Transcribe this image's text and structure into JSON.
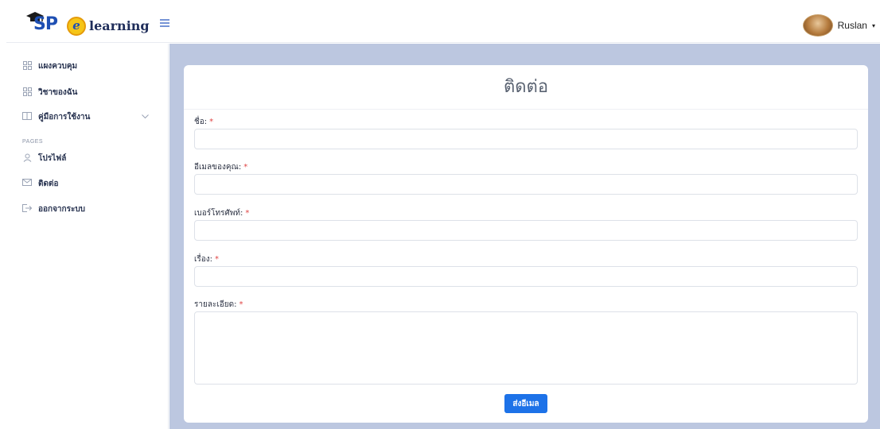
{
  "brand": {
    "logo_sp": "SP",
    "logo_e": "e",
    "logo_text": "learning"
  },
  "header": {
    "menu_icon": "hamburger-icon",
    "user_name": "Ruslan",
    "user_caret": "▾"
  },
  "sidebar": {
    "items": [
      {
        "label": "แผงควบคุม",
        "icon": "grid-icon"
      },
      {
        "label": "วิชาของฉัน",
        "icon": "grid-icon"
      },
      {
        "label": "คู่มือการใช้งาน",
        "icon": "book-icon"
      },
      {
        "label": "โปรไฟล์",
        "icon": "user-icon"
      },
      {
        "label": "ติดต่อ",
        "icon": "mail-icon"
      },
      {
        "label": "ออกจากระบบ",
        "icon": "logout-icon"
      }
    ],
    "section_label": "PAGES"
  },
  "form": {
    "title": "ติดต่อ",
    "fields": [
      {
        "label": "ชื่อ:",
        "required": "*",
        "value": ""
      },
      {
        "label": "อีเมลของคุณ:",
        "required": "*",
        "value": ""
      },
      {
        "label": "เบอร์โทรศัพท์:",
        "required": "*",
        "value": ""
      },
      {
        "label": "เรื่อง:",
        "required": "*",
        "value": ""
      },
      {
        "label": "รายละเอียด:",
        "required": "*",
        "value": ""
      }
    ],
    "submit_label": "ส่งอีเมล"
  },
  "colors": {
    "accent": "#1d72e8",
    "main_bg": "#bcc7e0",
    "required": "#e04444"
  }
}
